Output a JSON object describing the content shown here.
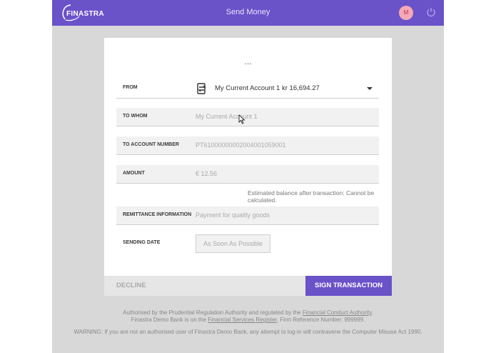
{
  "header": {
    "logo_text": "FINASTRA",
    "title": "Send Money",
    "avatar_initial": "M"
  },
  "card": {
    "loading_dots": "...",
    "from": {
      "label": "FROM",
      "value": "My Current Account 1 kr 16,694.27"
    },
    "to_whom": {
      "label": "TO WHOM",
      "value": "My Current Account 1"
    },
    "to_account_number": {
      "label": "TO ACCOUNT NUMBER",
      "value": "PT61000000002004001059001"
    },
    "amount": {
      "label": "AMOUNT",
      "value": "€ 12.56"
    },
    "estimated_balance": "Estimated balance after transaction: Cannot be calculated.",
    "remittance": {
      "label": "REMITTANCE INFORMATION",
      "value": "Payment for quality goods"
    },
    "sending_date": {
      "label": "SENDING DATE",
      "value": "As Soon As Possible"
    }
  },
  "actions": {
    "decline": "DECLINE",
    "sign": "SIGN TRANSACTION"
  },
  "footer": {
    "line1_prefix": "Authorised by the Prudential Regulation Authority and regulated by the",
    "line1_link": "Financial Conduct Authority",
    "line1_suffix": ".",
    "line2_prefix": "Finastra Demo Bank is on the",
    "line2_link": "Financial Services Register",
    "line2_suffix": ", Firm Reference Number: 999999.",
    "warning": "WARNING: If you are not an authorised user of Finastra Demo Bank, any attempt to log-in will contravene the Computer Misuse Act 1990."
  },
  "colors": {
    "brand": "#6a52c9",
    "background": "#d8d8d8",
    "avatar_bg": "#f4a9b4"
  },
  "icons": [
    "finastra-logo",
    "power-icon",
    "account-transfer-icon",
    "caret-down-icon",
    "mouse-cursor"
  ]
}
